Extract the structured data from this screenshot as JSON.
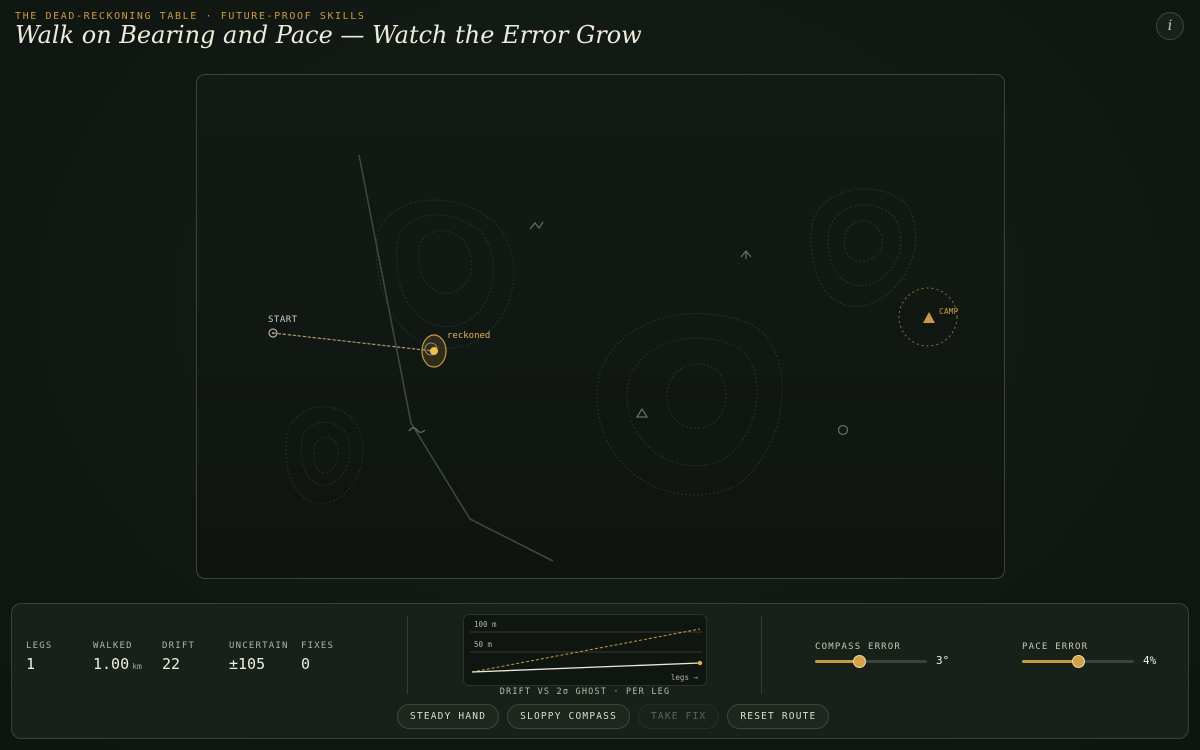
{
  "header": {
    "eyebrow": "THE DEAD-RECKONING TABLE · FUTURE-PROOF SKILLS",
    "title": "Walk on Bearing and Pace — Watch the Error Grow",
    "info_glyph": "i"
  },
  "map": {
    "start_label": "START",
    "reckoned_label": "reckoned",
    "camp_label": "CAMP"
  },
  "stats": [
    {
      "key": "legs",
      "label": "LEGS",
      "value": "1",
      "unit": ""
    },
    {
      "key": "walked",
      "label": "WALKED",
      "value": "1.00",
      "unit": "km"
    },
    {
      "key": "drift",
      "label": "DRIFT",
      "value": "22",
      "unit": ""
    },
    {
      "key": "uncertain",
      "label": "UNCERTAIN",
      "value": "±105",
      "unit": ""
    },
    {
      "key": "fixes",
      "label": "FIXES",
      "value": "0",
      "unit": ""
    }
  ],
  "sparkline": {
    "tick_100": "100 m",
    "tick_50": "50 m",
    "x_hint": "legs →",
    "caption": "DRIFT VS 2σ GHOST · PER LEG"
  },
  "sliders": {
    "compass": {
      "label": "COMPASS ERROR",
      "value_text": "3°",
      "fraction": 0.39
    },
    "pace": {
      "label": "PACE ERROR",
      "value_text": "4%",
      "fraction": 0.5
    }
  },
  "buttons": {
    "steady": "STEADY HAND",
    "sloppy": "SLOPPY COMPASS",
    "fix": "TAKE FIX",
    "reset": "RESET ROUTE"
  },
  "colors": {
    "accent": "#c99a45",
    "background": "#111813"
  }
}
